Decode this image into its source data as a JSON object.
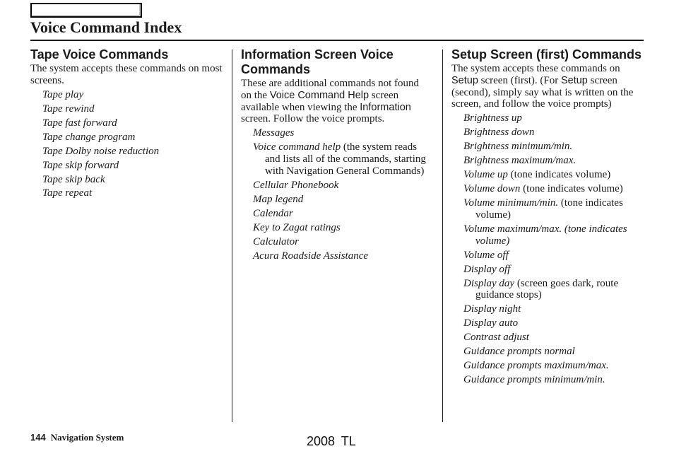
{
  "header": {
    "nav_box_label": "",
    "title": "Voice Command Index"
  },
  "columns": [
    {
      "heading": "Tape Voice Commands",
      "intro": [
        {
          "text": "The system accepts these commands on most screens.",
          "ui": false
        }
      ],
      "commands": [
        {
          "cmd": "Tape play",
          "note": ""
        },
        {
          "cmd": "Tape rewind",
          "note": ""
        },
        {
          "cmd": "Tape fast forward",
          "note": ""
        },
        {
          "cmd": "Tape change program",
          "note": ""
        },
        {
          "cmd": "Tape Dolby noise reduction",
          "note": ""
        },
        {
          "cmd": "Tape skip forward",
          "note": ""
        },
        {
          "cmd": "Tape skip back",
          "note": ""
        },
        {
          "cmd": "Tape repeat",
          "note": ""
        }
      ]
    },
    {
      "heading": "Information Screen Voice Commands",
      "intro": [
        {
          "text": "These are additional commands not found on the ",
          "ui": false
        },
        {
          "text": "Voice Command Help",
          "ui": true
        },
        {
          "text": " screen available when viewing the ",
          "ui": false
        },
        {
          "text": "Information",
          "ui": true
        },
        {
          "text": " screen. Follow the voice prompts.",
          "ui": false
        }
      ],
      "commands": [
        {
          "cmd": "Messages",
          "note": ""
        },
        {
          "cmd": "Voice command help",
          "note": " (the system reads and lists all of the commands, starting with Navigation General Commands)"
        },
        {
          "cmd": "Cellular Phonebook",
          "note": ""
        },
        {
          "cmd": "Map legend",
          "note": ""
        },
        {
          "cmd": "Calendar",
          "note": ""
        },
        {
          "cmd": "Key to Zagat ratings",
          "note": ""
        },
        {
          "cmd": "Calculator",
          "note": ""
        },
        {
          "cmd": "Acura Roadside Assistance",
          "note": ""
        }
      ]
    },
    {
      "heading": "Setup Screen (first) Commands",
      "intro": [
        {
          "text": "The system accepts these commands on ",
          "ui": false
        },
        {
          "text": "Setup",
          "ui": true
        },
        {
          "text": " screen (first). (For ",
          "ui": false
        },
        {
          "text": "Setup",
          "ui": true
        },
        {
          "text": " screen (second), simply say what is written on the screen, and follow the voice prompts)",
          "ui": false
        }
      ],
      "commands": [
        {
          "cmd": "Brightness up",
          "note": ""
        },
        {
          "cmd": "Brightness down",
          "note": ""
        },
        {
          "cmd": "Brightness minimum/min.",
          "note": ""
        },
        {
          "cmd": "Brightness maximum/max.",
          "note": ""
        },
        {
          "cmd": "Volume up",
          "note": " (tone indicates volume)"
        },
        {
          "cmd": "Volume down",
          "note": " (tone indicates volume)"
        },
        {
          "cmd": "Volume minimum/min.",
          "note": " (tone indicates volume)"
        },
        {
          "cmd": "Volume maximum/max. (tone indicates volume)",
          "note": ""
        },
        {
          "cmd": "Volume off",
          "note": ""
        },
        {
          "cmd": "Display off",
          "note": ""
        },
        {
          "cmd": "Display day",
          "note": " (screen goes dark, route guidance stops)"
        },
        {
          "cmd": "Display night",
          "note": ""
        },
        {
          "cmd": "Display auto",
          "note": ""
        },
        {
          "cmd": "Contrast adjust",
          "note": ""
        },
        {
          "cmd": "Guidance prompts normal",
          "note": ""
        },
        {
          "cmd": "Guidance prompts maximum/max.",
          "note": ""
        },
        {
          "cmd": "Guidance prompts minimum/min.",
          "note": ""
        }
      ]
    }
  ],
  "footer": {
    "page_number": "144",
    "section": "Navigation System",
    "model": "2008  TL"
  }
}
